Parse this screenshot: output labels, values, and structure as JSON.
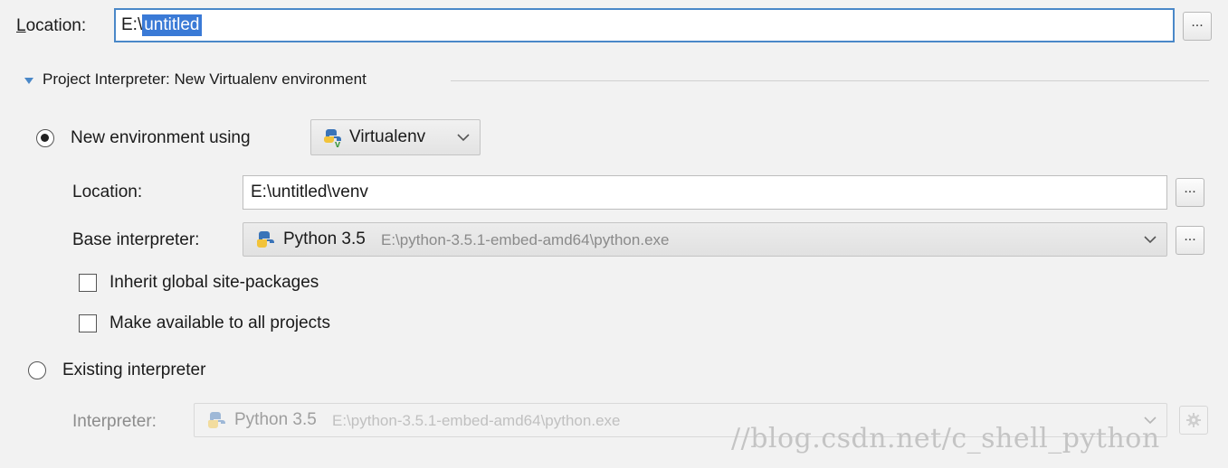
{
  "project": {
    "location_label": "Location:",
    "location_mnemonic": "L",
    "location_rest": "ocation:",
    "location_prefix": "E:\\",
    "location_selected": "untitled",
    "browse_label": "..."
  },
  "interpreter_section": {
    "title": "Project Interpreter: New Virtualenv environment"
  },
  "new_env": {
    "radio_label": "New environment using",
    "selected": true,
    "tool": "Virtualenv",
    "location_label": "Location:",
    "location_value": "E:\\untitled\\venv",
    "base_label": "Base interpreter:",
    "base_name": "Python 3.5",
    "base_path": "E:\\python-3.5.1-embed-amd64\\python.exe",
    "inherit_label": "Inherit global site-packages",
    "inherit_checked": false,
    "available_label": "Make available to all projects",
    "available_checked": false,
    "browse_label": "..."
  },
  "existing": {
    "radio_label": "Existing interpreter",
    "selected": false,
    "interpreter_label": "Interpreter:",
    "interp_name": "Python 3.5",
    "interp_path": "E:\\python-3.5.1-embed-amd64\\python.exe"
  },
  "watermark": "//blog.csdn.net/c_shell_python",
  "icons": {
    "python": "python-logo-icon",
    "virtualenv": "python-virtualenv-icon",
    "chevron": "chevron-down-icon",
    "triangle": "expand-triangle-icon",
    "gear": "gear-icon"
  },
  "colors": {
    "accent": "#4a88c8",
    "selection": "#3a7ad6",
    "background": "#f2f2f2"
  }
}
